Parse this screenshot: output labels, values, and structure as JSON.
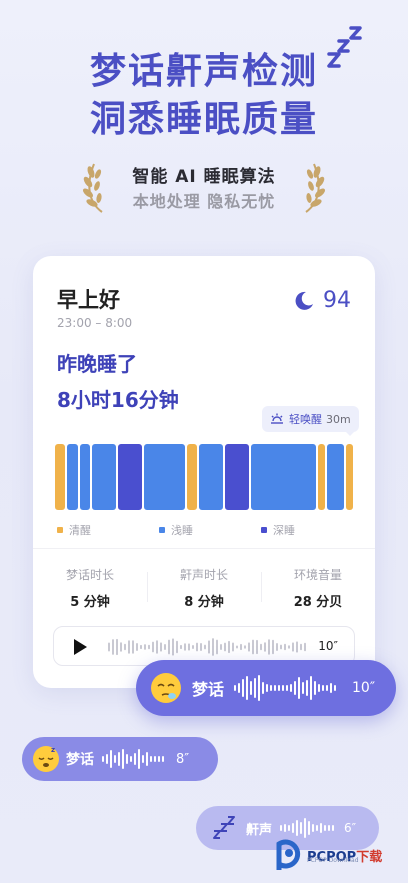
{
  "hero": {
    "title_line1": "梦话鼾声检测",
    "title_line2": "洞悉睡眠质量",
    "tagline1": "智能 AI 睡眠算法",
    "tagline2": "本地处理 隐私无忧"
  },
  "card": {
    "greeting": "早上好",
    "time_range": "23:00 – 8:00",
    "score": "94",
    "slept_prefix": "昨晚睡了",
    "slept_duration": "8小时16分钟",
    "wake_label": "轻唤醒",
    "wake_duration": "30m",
    "sleep_stages": [
      {
        "stage": "awake",
        "weight": 3
      },
      {
        "stage": "light",
        "weight": 3
      },
      {
        "stage": "light",
        "weight": 3
      },
      {
        "stage": "light",
        "weight": 7
      },
      {
        "stage": "deep",
        "weight": 7
      },
      {
        "stage": "light",
        "weight": 12
      },
      {
        "stage": "awake",
        "weight": 3
      },
      {
        "stage": "light",
        "weight": 7
      },
      {
        "stage": "deep",
        "weight": 7
      },
      {
        "stage": "light",
        "weight": 19
      },
      {
        "stage": "awake",
        "weight": 2
      },
      {
        "stage": "light",
        "weight": 5
      },
      {
        "stage": "awake",
        "weight": 2
      }
    ],
    "legend": [
      {
        "label": "清醒",
        "color": "#f0b24a"
      },
      {
        "label": "浅睡",
        "color": "#4a86e8"
      },
      {
        "label": "深睡",
        "color": "#4a4fcf"
      }
    ],
    "metrics": [
      {
        "label": "梦话时长",
        "value": "5 分钟"
      },
      {
        "label": "鼾声时长",
        "value": "8 分钟"
      },
      {
        "label": "环境音量",
        "value": "28 分贝"
      }
    ],
    "player": {
      "duration": "10″",
      "play_icon": "play-icon"
    }
  },
  "bubbles": [
    {
      "icon": "sleepy-face-emoji",
      "label": "梦话",
      "duration": "10″"
    },
    {
      "icon": "sleeping-face-emoji",
      "label": "梦话",
      "duration": "8″"
    },
    {
      "icon": "zzz-icon",
      "label": "鼾声",
      "duration": "6″"
    }
  ],
  "watermark": {
    "brand": "PCPOP",
    "brand_cn": "下载",
    "sub": "PCPOP Download"
  },
  "colors": {
    "brand": "#4b4fc4",
    "awake": "#f0b24a",
    "light": "#4a86e8",
    "deep": "#4a4fcf"
  }
}
